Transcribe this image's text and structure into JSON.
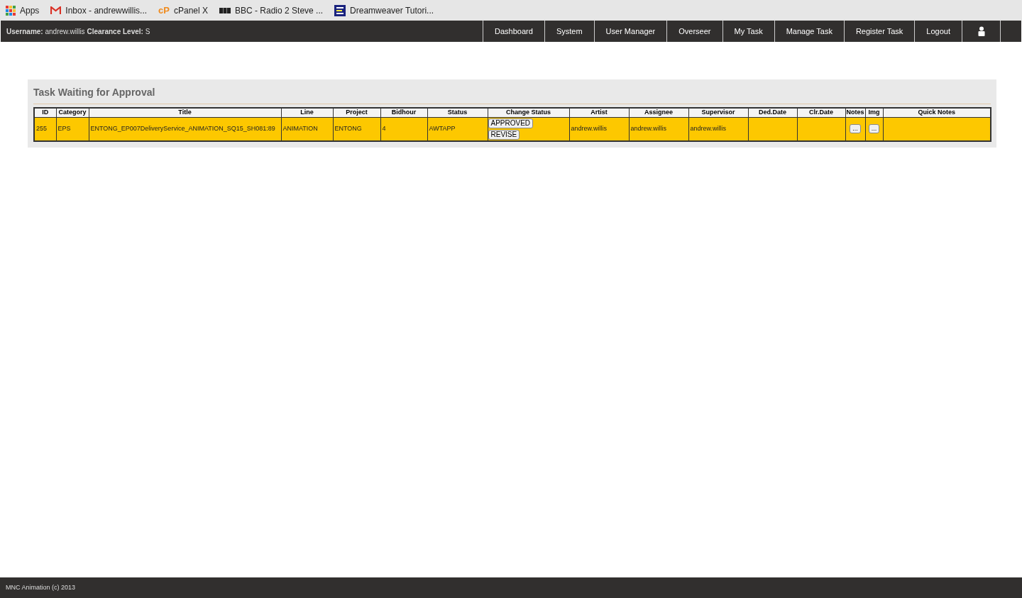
{
  "bookmarks": [
    {
      "kind": "apps",
      "label": "Apps"
    },
    {
      "kind": "gmail",
      "label": "Inbox - andrewwillis..."
    },
    {
      "kind": "cpanel",
      "icon_text": "cP",
      "label": "cPanel X"
    },
    {
      "kind": "bbc",
      "label": "BBC - Radio 2 Steve ..."
    },
    {
      "kind": "site",
      "label": "Dreamweaver Tutori..."
    }
  ],
  "header": {
    "user_label": "Username:",
    "user": "andrew.willis",
    "clearance_label": "Clearance Level:",
    "clearance": "S",
    "nav": [
      {
        "kind": "text",
        "label": "Dashboard"
      },
      {
        "kind": "text",
        "label": "System"
      },
      {
        "kind": "text",
        "label": "User Manager"
      },
      {
        "kind": "text",
        "label": "Overseer"
      },
      {
        "kind": "text",
        "label": "My Task"
      },
      {
        "kind": "text",
        "label": "Manage Task"
      },
      {
        "kind": "text",
        "label": "Register Task"
      },
      {
        "kind": "text",
        "label": "Logout"
      },
      {
        "kind": "user"
      }
    ]
  },
  "panel": {
    "title": "Task Waiting for Approval",
    "columns": [
      "ID",
      "Category",
      "Title",
      "Line",
      "Project",
      "Bidhour",
      "Status",
      "Change Status",
      "Artist",
      "Assignee",
      "Supervisor",
      "Ded.Date",
      "Clr.Date",
      "Notes",
      "Img",
      "Quick Notes"
    ],
    "rows": [
      {
        "cells": [
          {
            "kind": "text",
            "text": "255"
          },
          {
            "kind": "text",
            "text": "EPS"
          },
          {
            "kind": "text",
            "text": "ENTONG_EP007DeliveryService_ANIMATION_SQ15_SH081:89"
          },
          {
            "kind": "text",
            "text": "ANIMATION"
          },
          {
            "kind": "text",
            "text": "ENTONG"
          },
          {
            "kind": "text",
            "text": "4"
          },
          {
            "kind": "text",
            "text": "AWTAPP"
          },
          {
            "kind": "buttons",
            "buttons": [
              "APPROVED",
              "REVISE"
            ]
          },
          {
            "kind": "text",
            "text": "andrew.willis"
          },
          {
            "kind": "text",
            "text": "andrew.willis"
          },
          {
            "kind": "text",
            "text": "andrew.willis"
          },
          {
            "kind": "empty"
          },
          {
            "kind": "empty"
          },
          {
            "kind": "button",
            "text": "..."
          },
          {
            "kind": "button",
            "text": "..."
          },
          {
            "kind": "empty"
          }
        ]
      }
    ]
  },
  "footer": "MNC Animation (c) 2013"
}
